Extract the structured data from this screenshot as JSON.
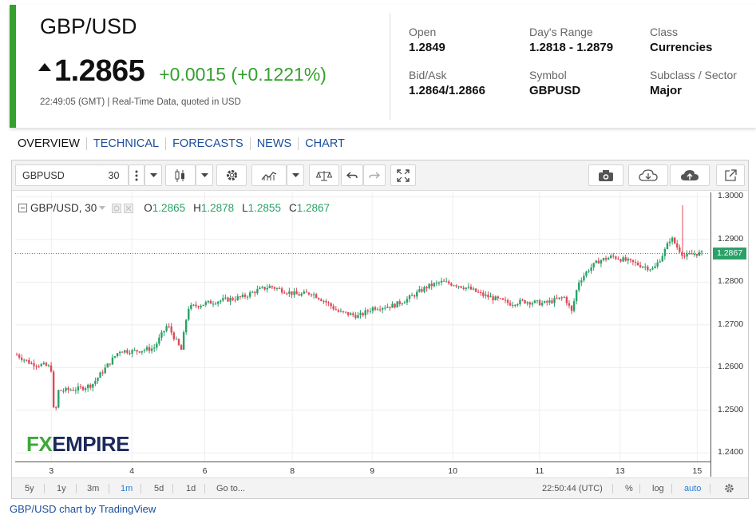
{
  "quote": {
    "name": "GBP/USD",
    "price": "1.2865",
    "change": "+0.0015 (+0.1221%)",
    "timestamp": "22:49:05 (GMT) |  Real-Time Data, quoted in USD",
    "stats": [
      {
        "label": "Open",
        "value": "1.2849"
      },
      {
        "label": "Day's Range",
        "value": "1.2818 - 1.2879"
      },
      {
        "label": "Class",
        "value": "Currencies"
      },
      {
        "label": "Bid/Ask",
        "value": "1.2864/1.2866"
      },
      {
        "label": "Symbol",
        "value": "GBPUSD"
      },
      {
        "label": "Subclass / Sector",
        "value": "Major"
      }
    ],
    "accent": "#34a02d"
  },
  "tabs": [
    "OVERVIEW",
    "TECHNICAL",
    "FORECASTS",
    "NEWS",
    "CHART"
  ],
  "toolbar": {
    "symbol": "GBPUSD",
    "interval": "30",
    "icons": [
      "menu-dots-icon",
      "dropdown-icon",
      "candles-icon",
      "gear-icon",
      "indicators-icon",
      "compare-icon",
      "undo-icon",
      "redo-icon",
      "fullscreen-icon",
      "camera-icon",
      "cloud-download-icon",
      "cloud-upload-icon",
      "popout-icon"
    ]
  },
  "legend": {
    "title": "GBP/USD, 30",
    "o_label": "O",
    "o": "1.2865",
    "h_label": "H",
    "h": "1.2878",
    "l_label": "L",
    "l": "1.2855",
    "c_label": "C",
    "c": "1.2867"
  },
  "current_price_label": "1.2867",
  "logo": {
    "fx": "FX",
    "rest": "EMPIRE"
  },
  "bottom_bar": {
    "ranges": [
      "5y",
      "1y",
      "3m",
      "1m",
      "5d",
      "1d",
      "Go to..."
    ],
    "active_range": "1m",
    "clock": "22:50:44 (UTC)",
    "percent": "%",
    "log": "log",
    "auto": "auto"
  },
  "footer_link": "GBP/USD chart by TradingView",
  "colors": {
    "up": "#2aa168",
    "down": "#e04a59",
    "grid": "#eeeeee",
    "price_line": "#2aa168"
  },
  "chart_data": {
    "type": "candlestick",
    "title": "GBP/USD, 30",
    "y_ticks": [
      "1.3000",
      "1.2900",
      "1.2800",
      "1.2700",
      "1.2600",
      "1.2500",
      "1.2400"
    ],
    "x_ticks": [
      "3",
      "4",
      "6",
      "8",
      "9",
      "10",
      "11",
      "13",
      "15"
    ],
    "ylim": [
      1.238,
      1.301
    ],
    "close_path": [
      [
        0.0,
        1.263
      ],
      [
        0.02,
        1.261
      ],
      [
        0.04,
        1.2605
      ],
      [
        0.05,
        1.26
      ],
      [
        0.055,
        1.247
      ],
      [
        0.06,
        1.2545
      ],
      [
        0.09,
        1.255
      ],
      [
        0.11,
        1.256
      ],
      [
        0.13,
        1.26
      ],
      [
        0.15,
        1.264
      ],
      [
        0.17,
        1.2638
      ],
      [
        0.2,
        1.2645
      ],
      [
        0.22,
        1.27
      ],
      [
        0.24,
        1.264
      ],
      [
        0.25,
        1.274
      ],
      [
        0.27,
        1.2748
      ],
      [
        0.29,
        1.2755
      ],
      [
        0.31,
        1.276
      ],
      [
        0.33,
        1.2765
      ],
      [
        0.35,
        1.278
      ],
      [
        0.37,
        1.279
      ],
      [
        0.39,
        1.278
      ],
      [
        0.41,
        1.277
      ],
      [
        0.43,
        1.2775
      ],
      [
        0.45,
        1.2755
      ],
      [
        0.47,
        1.273
      ],
      [
        0.5,
        1.272
      ],
      [
        0.52,
        1.274
      ],
      [
        0.55,
        1.2745
      ],
      [
        0.57,
        1.276
      ],
      [
        0.6,
        1.279
      ],
      [
        0.62,
        1.28
      ],
      [
        0.64,
        1.2795
      ],
      [
        0.66,
        1.2785
      ],
      [
        0.68,
        1.277
      ],
      [
        0.7,
        1.276
      ],
      [
        0.72,
        1.275
      ],
      [
        0.74,
        1.2755
      ],
      [
        0.77,
        1.275
      ],
      [
        0.8,
        1.2765
      ],
      [
        0.81,
        1.273
      ],
      [
        0.82,
        1.28
      ],
      [
        0.835,
        1.283
      ],
      [
        0.85,
        1.285
      ],
      [
        0.87,
        1.286
      ],
      [
        0.89,
        1.285
      ],
      [
        0.91,
        1.284
      ],
      [
        0.93,
        1.283
      ],
      [
        0.945,
        1.287
      ],
      [
        0.955,
        1.2905
      ],
      [
        0.965,
        1.288
      ],
      [
        0.975,
        1.286
      ],
      [
        0.99,
        1.2867
      ]
    ],
    "last_close": 1.2867
  }
}
